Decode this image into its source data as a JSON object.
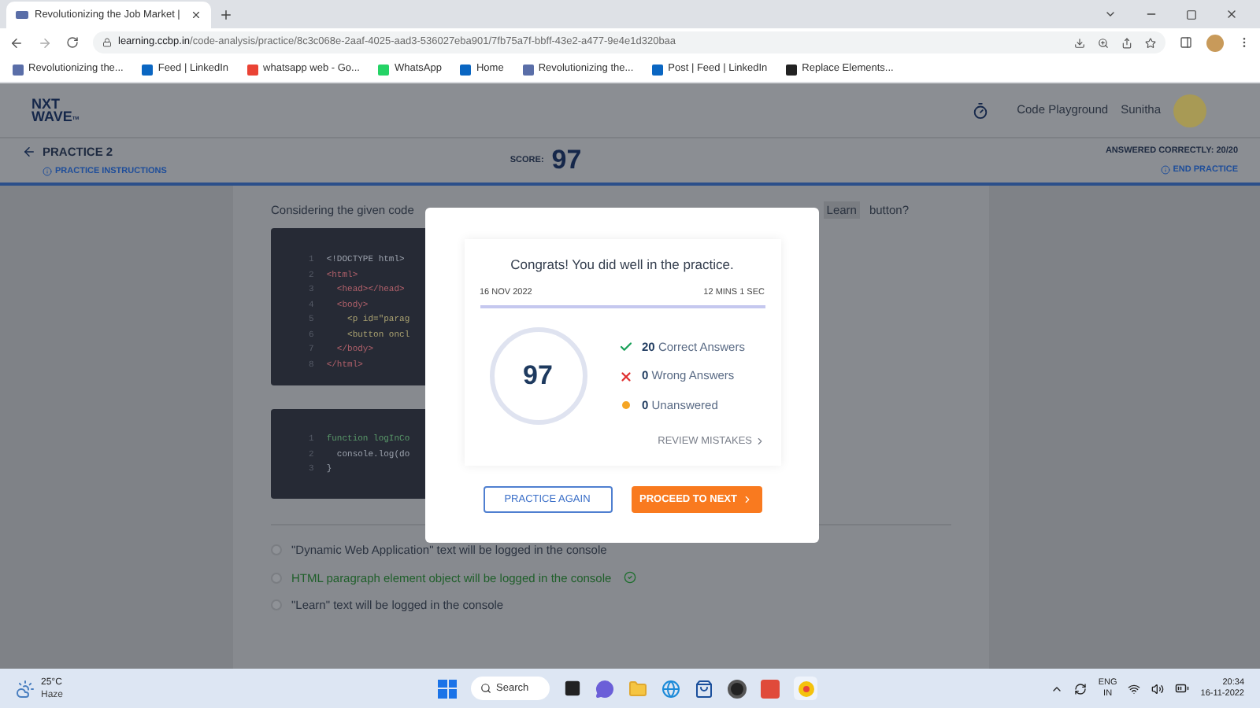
{
  "browser": {
    "tab_title": "Revolutionizing the Job Market |",
    "url_host": "learning.ccbp.in",
    "url_path": "/code-analysis/practice/8c3c068e-2aaf-4025-aad3-536027eba901/7fb75a7f-bbff-43e2-a477-9e4e1d320baa",
    "bookmarks": [
      {
        "label": "Revolutionizing the...",
        "kind": "site"
      },
      {
        "label": "Feed | LinkedIn",
        "kind": "linkedin"
      },
      {
        "label": "whatsapp web - Go...",
        "kind": "google"
      },
      {
        "label": "WhatsApp",
        "kind": "whatsapp"
      },
      {
        "label": "Home",
        "kind": "linkedin"
      },
      {
        "label": "Revolutionizing the...",
        "kind": "site"
      },
      {
        "label": "Post | Feed | LinkedIn",
        "kind": "linkedin"
      },
      {
        "label": "Replace Elements...",
        "kind": "dark"
      }
    ]
  },
  "header": {
    "logo_lines": [
      "NXT",
      "WAVE"
    ],
    "logo_mark": "TM",
    "nav_link": "Code Playground",
    "user": "Sunitha"
  },
  "subheader": {
    "title": "PRACTICE 2",
    "instructions": "PRACTICE INSTRUCTIONS",
    "score_label": "SCORE:",
    "score": "97",
    "answered": "ANSWERED CORRECTLY: 20/20",
    "end": "END PRACTICE"
  },
  "question": {
    "prefix": "Considering the given code",
    "chip": "Learn",
    "suffix": "button?"
  },
  "code_blocks": [
    {
      "lines": [
        {
          "number": "1",
          "text": "<!DOCTYPE html>",
          "kind": "plain"
        },
        {
          "number": "2",
          "text": "<html>",
          "kind": "tag"
        },
        {
          "number": "3",
          "text": "  <head></head>",
          "kind": "tag"
        },
        {
          "number": "4",
          "text": "  <body>",
          "kind": "tag"
        },
        {
          "number": "5",
          "text": "    <p id=\"parag",
          "kind": "attr"
        },
        {
          "number": "6",
          "text": "    <button oncl",
          "kind": "attr"
        },
        {
          "number": "7",
          "text": "  </body>",
          "kind": "tag"
        },
        {
          "number": "8",
          "text": "</html>",
          "kind": "tag"
        }
      ]
    },
    {
      "lines": [
        {
          "number": "1",
          "text": "function logInCo",
          "kind": "keyword"
        },
        {
          "number": "2",
          "text": "  console.log(do",
          "kind": "plain"
        },
        {
          "number": "3",
          "text": "}",
          "kind": "plain"
        }
      ]
    }
  ],
  "options": [
    {
      "text": "\"Dynamic Web Application\" text will be logged in the console",
      "correct": false
    },
    {
      "text": "HTML paragraph element object will be logged in the console",
      "correct": true
    },
    {
      "text": "\"Learn\" text will be logged in the console",
      "correct": false
    }
  ],
  "modal": {
    "heading": "Congrats! You did well in the practice.",
    "date": "16 NOV 2022",
    "duration": "12 MINS 1 SEC",
    "score": "97",
    "stats": [
      {
        "kind": "correct",
        "count": "20",
        "label": "Correct Answers"
      },
      {
        "kind": "wrong",
        "count": "0",
        "label": "Wrong Answers"
      },
      {
        "kind": "unanswered",
        "count": "0",
        "label": "Unanswered"
      }
    ],
    "review": "REVIEW MISTAKES",
    "secondary_button": "PRACTICE AGAIN",
    "primary_button": "PROCEED TO NEXT"
  },
  "taskbar": {
    "temperature": "25°C",
    "weather": "Haze",
    "search": "Search",
    "language": "ENG",
    "region": "IN",
    "time": "20:34",
    "date": "16-11-2022"
  }
}
